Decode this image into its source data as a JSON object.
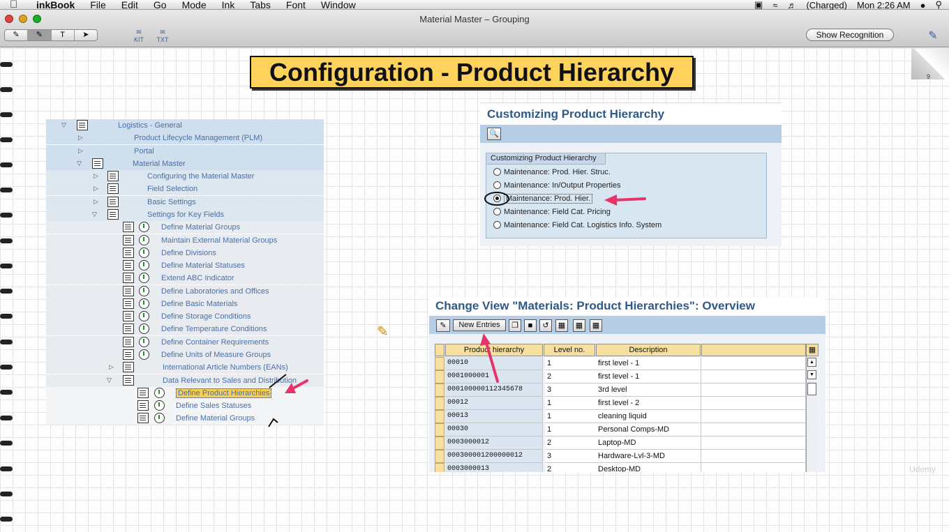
{
  "menubar": {
    "app": "inkBook",
    "items": [
      "File",
      "Edit",
      "Go",
      "Mode",
      "Ink",
      "Tabs",
      "Font",
      "Window"
    ],
    "battery": "(Charged)",
    "clock": "Mon 2:26 AM"
  },
  "window": {
    "title": "Material Master – Grouping",
    "tools": [
      "KIT",
      "TXT"
    ],
    "show_recognition": "Show Recognition",
    "page_number": "9"
  },
  "banner": {
    "title": "Configuration - Product Hierarchy"
  },
  "tree": {
    "rows": [
      {
        "label": "Logistics - General"
      },
      {
        "label": "Product Lifecycle Management (PLM)"
      },
      {
        "label": "Portal"
      },
      {
        "label": "Material Master"
      },
      {
        "label": "Configuring the Material Master"
      },
      {
        "label": "Field Selection"
      },
      {
        "label": "Basic Settings"
      },
      {
        "label": "Settings for Key Fields"
      },
      {
        "label": "Define Material Groups"
      },
      {
        "label": "Maintain External Material Groups"
      },
      {
        "label": "Define Divisions"
      },
      {
        "label": "Define Material Statuses"
      },
      {
        "label": "Extend ABC Indicator"
      },
      {
        "label": "Define Laboratories and Offices"
      },
      {
        "label": "Define Basic Materials"
      },
      {
        "label": "Define Storage Conditions"
      },
      {
        "label": "Define Temperature Conditions"
      },
      {
        "label": "Define Container Requirements"
      },
      {
        "label": "Define Units of Measure Groups"
      },
      {
        "label": "International Article Numbers (EANs)"
      },
      {
        "label": "Data Relevant to Sales and Distribution"
      },
      {
        "label": "Define Product Hierarchies"
      },
      {
        "label": "Define Sales Statuses"
      },
      {
        "label": "Define Material Groups"
      }
    ]
  },
  "customizing": {
    "title": "Customizing Product Hierarchy",
    "group_title": "Customizing Product Hierarchy",
    "options": [
      "Maintenance: Prod. Hier. Struc.",
      "Maintenance: In/Output Properties",
      "Maintenance: Prod. Hier.",
      "Maintenance: Field Cat. Pricing",
      "Maintenance: Field Cat. Logistics Info. System"
    ],
    "selected_index": 2
  },
  "change_view": {
    "title": "Change View \"Materials: Product Hierarchies\": Overview",
    "new_entries": "New Entries",
    "columns": [
      "Product hierarchy",
      "Level no.",
      "Description"
    ],
    "rows": [
      [
        "00010",
        "1",
        "first level - 1"
      ],
      [
        "0001000001",
        "2",
        "first level - 1"
      ],
      [
        "000100000112345678",
        "3",
        "3rd level"
      ],
      [
        "00012",
        "1",
        "first level - 2"
      ],
      [
        "00013",
        "1",
        "cleaning liquid"
      ],
      [
        "00030",
        "1",
        "Personal Comps-MD"
      ],
      [
        "0003000012",
        "2",
        "Laptop-MD"
      ],
      [
        "000300001200000012",
        "3",
        "Hardware-Lvl-3-MD"
      ],
      [
        "0003000013",
        "2",
        "Desktop-MD"
      ]
    ]
  },
  "watermark": "Udemy"
}
